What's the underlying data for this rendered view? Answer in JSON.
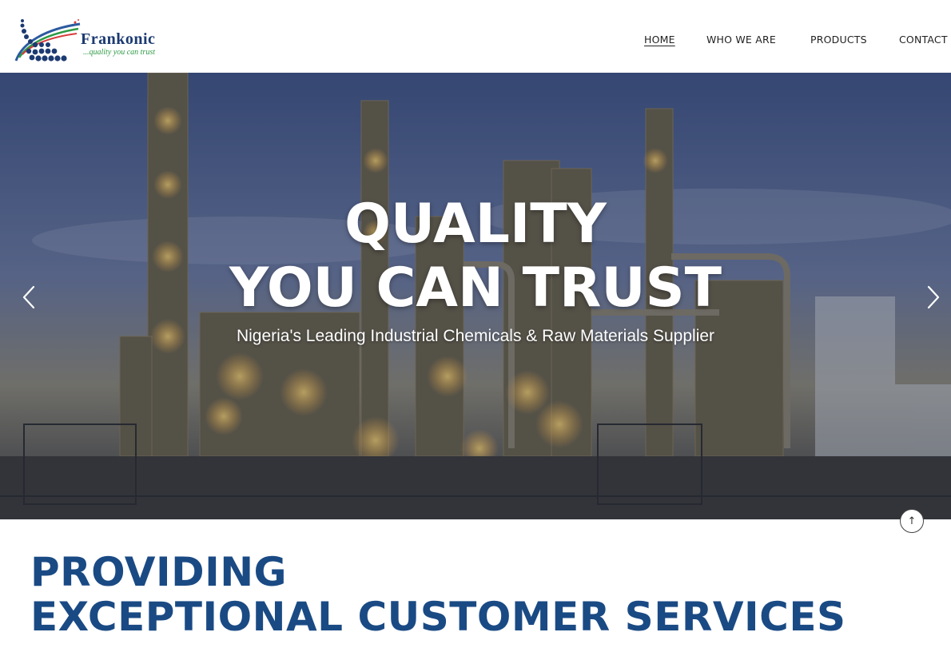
{
  "brand": {
    "name": "Frankonic",
    "tagline": "...quality you can trust"
  },
  "nav": {
    "items": [
      {
        "label": "HOME",
        "active": true
      },
      {
        "label": "WHO WE ARE",
        "active": false
      },
      {
        "label": "PRODUCTS",
        "active": false
      },
      {
        "label": "CONTACT",
        "active": false
      }
    ]
  },
  "hero": {
    "title_line1": "QUALITY",
    "title_line2": "YOU CAN TRUST",
    "subtitle": "Nigeria's Leading Industrial Chemicals & Raw Materials Supplier",
    "prev_icon": "chevron-left-icon",
    "next_icon": "chevron-right-icon"
  },
  "section": {
    "heading_line1": "PROVIDING",
    "heading_line2": "EXCEPTIONAL CUSTOMER SERVICES"
  },
  "scroll_top_icon": "arrow-up-icon",
  "colors": {
    "brand_blue": "#1a4a84",
    "logo_navy": "#1c3a72",
    "logo_green": "#2e9a45",
    "text_dark": "#222222"
  }
}
